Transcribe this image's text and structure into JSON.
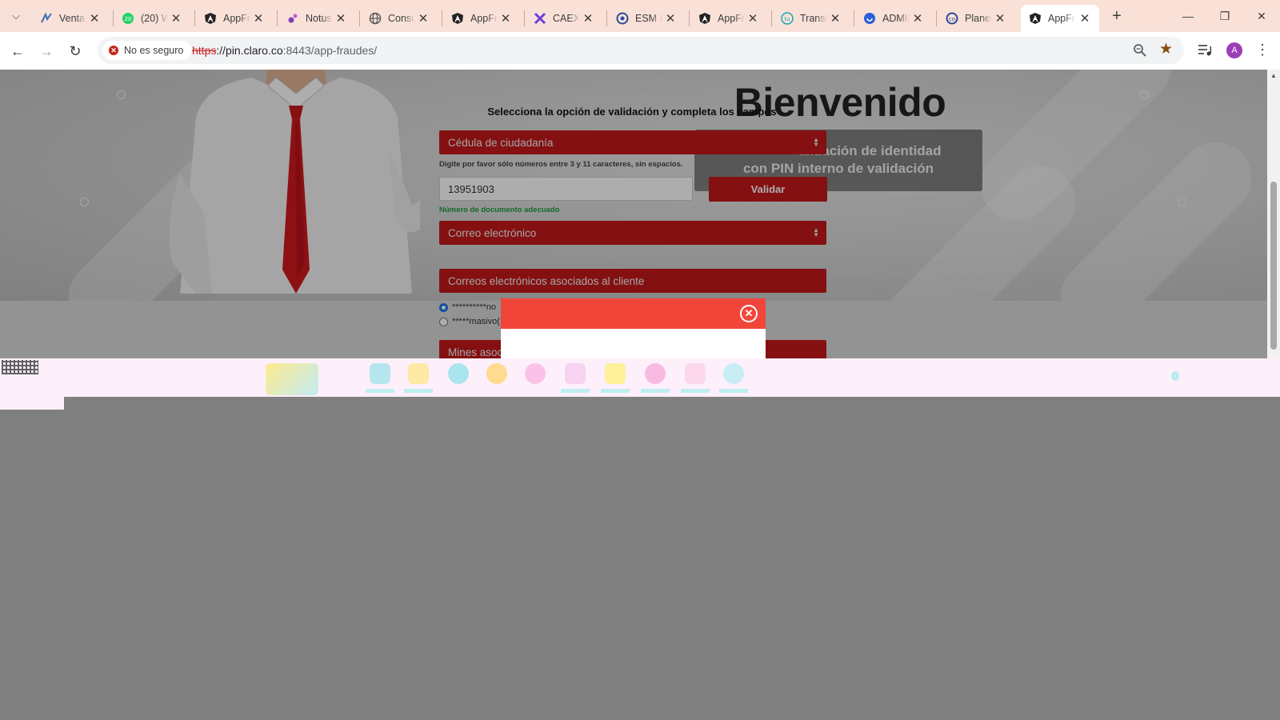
{
  "browser": {
    "tabs": [
      {
        "label": "Ventas",
        "icon": "ventas-favicon-icon",
        "active": false
      },
      {
        "label": "(20) W",
        "icon": "whatsapp-favicon-icon",
        "active": false
      },
      {
        "label": "AppFraudes",
        "icon": "angular-favicon-icon",
        "active": false
      },
      {
        "label": "Notus",
        "icon": "notus-favicon-icon",
        "active": false
      },
      {
        "label": "Consulta",
        "icon": "globe-favicon-icon",
        "active": false
      },
      {
        "label": "AppFraudes",
        "icon": "angular-favicon-icon",
        "active": false
      },
      {
        "label": "CAEX",
        "icon": "caex-favicon-icon",
        "active": false
      },
      {
        "label": "ESM L",
        "icon": "esm-favicon-icon",
        "active": false
      },
      {
        "label": "AppFraudes",
        "icon": "angular-favicon-icon",
        "active": false
      },
      {
        "label": "Translate",
        "icon": "translate-favicon-icon",
        "active": false
      },
      {
        "label": "ADMIN",
        "icon": "admin-favicon-icon",
        "active": false
      },
      {
        "label": "Planeta",
        "icon": "planeta-favicon-icon",
        "active": false
      },
      {
        "label": "AppFraudes",
        "icon": "angular-favicon-icon",
        "active": true
      }
    ],
    "security_label": "No es seguro",
    "url_scheme": "https",
    "url_host": "://pin.claro.co",
    "url_rest": ":8443/app-fraudes/",
    "profile_initial": "A",
    "colors": {
      "tabbar": "#f9e1d8",
      "insecure": "#c5221f",
      "star": "#8a4d12",
      "avatar": "#9c3fb5"
    }
  },
  "page": {
    "welcome_title": "Bienvenido",
    "welcome_subtitle_line1": "alidación de identidad",
    "welcome_subtitle_line2": "con PIN interno de validación",
    "form_heading": "Selecciona la opción de validación y completa los campos",
    "doc_type_select": "Cédula de ciudadanía",
    "doc_hint": "Digite por favor sólo números entre 3 y 11 caracteres, sin espacios.",
    "doc_number": "13951903",
    "validate_label": "Validar",
    "doc_ok_message": "Número de documento adecuado",
    "contact_select": "Correo electrónico",
    "emails_header": "Correos electrónicos asociados al cliente",
    "email_options": [
      {
        "label": "**********no",
        "checked": true
      },
      {
        "label": "*****masivo(",
        "checked": false
      }
    ],
    "mines_header": "Mines asoc",
    "colors": {
      "primary_red": "#c3191b",
      "modal_header": "#f2453a",
      "success_green": "#1b9c3a"
    }
  },
  "modal": {
    "close_icon": "close-circle-icon"
  }
}
